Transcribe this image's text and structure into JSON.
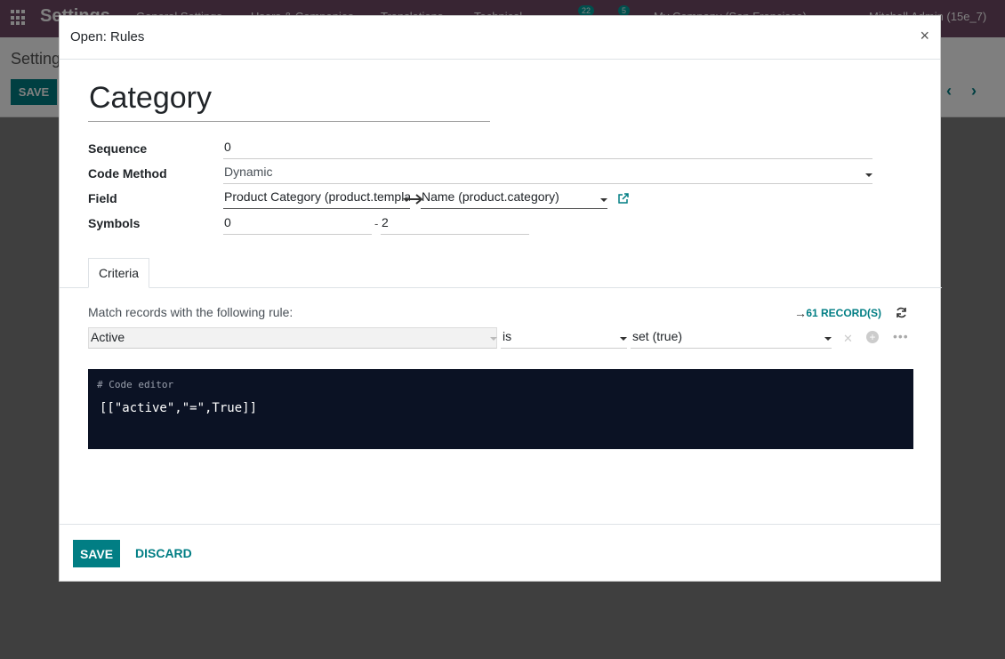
{
  "background": {
    "brand": "Settings",
    "menu": [
      "General Settings",
      "Users & Companies",
      "Translations",
      "Technical"
    ],
    "badges": [
      "22",
      "5"
    ],
    "company": "My Company (San Francisco)",
    "user": "Mitchell Admin (15e_7)",
    "breadcrumb": "Setting",
    "save_label": "SAVE"
  },
  "modal": {
    "title": "Open: Rules",
    "close": "×",
    "record_name": "Category",
    "fields": {
      "sequence_label": "Sequence",
      "sequence_value": "0",
      "code_method_label": "Code Method",
      "code_method_value": "Dynamic",
      "field_label": "Field",
      "field_value_1": "Product Category (product.templa",
      "field_value_2": "Name (product.category)",
      "symbols_label": "Symbols",
      "symbols_from": "0",
      "symbols_sep": "-",
      "symbols_to": "2"
    },
    "tabs": [
      {
        "label": "Criteria"
      }
    ],
    "criteria": {
      "match_text": "Match records with the following rule:",
      "records": "61 RECORD(S)",
      "rule_field": "Active",
      "rule_operator": "is",
      "rule_value": "set (true)"
    },
    "code_editor": {
      "comment": "# Code editor",
      "code": "[[\"active\",\"=\",True]]"
    },
    "footer": {
      "save": "SAVE",
      "discard": "DISCARD"
    }
  },
  "colors": {
    "primary": "#017e84",
    "topbar": "#714b67",
    "code_bg": "#0b1224"
  }
}
